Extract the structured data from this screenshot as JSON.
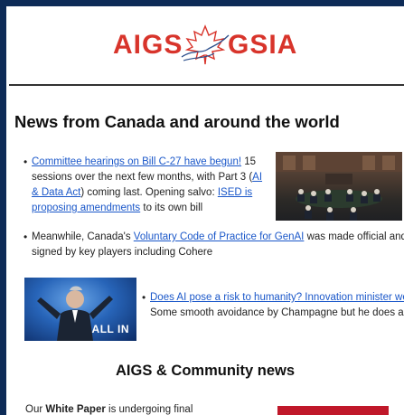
{
  "logo": {
    "left": "AIGS",
    "right": "GSIA",
    "alt": "AIGS GSIA logo"
  },
  "news_heading": "News from Canada and around the world",
  "item1": {
    "link1": "Committee hearings on Bill C-27 have begun!",
    "text1": " 15 sessions over the next few months, with Part 3 (",
    "link2": "AI & Data Act",
    "text2": ") coming last. Opening salvo: ",
    "link3": "ISED is proposing amendments",
    "text3": " to its own bill"
  },
  "item2": {
    "text1": "Meanwhile, Canada's ",
    "link1": "Voluntary Code of Practice for GenAI",
    "text2": " was made official and signed by key players including Cohere"
  },
  "item3": {
    "link1": "Does AI pose a risk to humanity? Innovation minister won't say",
    "text1": " Some smooth avoidance by Champagne but he does acknowledge the concerns"
  },
  "photo2_caption": "ALL IN",
  "community_heading": "AIGS & Community news",
  "white_paper": {
    "text1": "Our ",
    "bold": "White Paper",
    "text2": " is undergoing final"
  },
  "colors": {
    "brand_red": "#d8342b",
    "frame_navy": "#0d2b57",
    "link_blue": "#1a57c9"
  }
}
